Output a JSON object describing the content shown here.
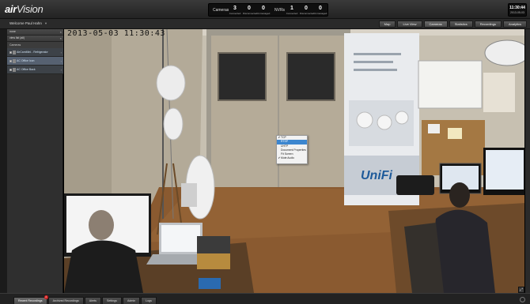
{
  "app": {
    "logo_prefix": "air",
    "logo_main": "Vision"
  },
  "stats": {
    "cameras_label": "Cameras",
    "nvrs_label": "NVRs",
    "cameras": [
      {
        "value": "3",
        "sub": "Connected"
      },
      {
        "value": "0",
        "sub": "Disconnected"
      },
      {
        "value": "0",
        "sub": "Unmanaged"
      }
    ],
    "nvrs": [
      {
        "value": "1",
        "sub": "Connected"
      },
      {
        "value": "0",
        "sub": "Disconnected"
      },
      {
        "value": "0",
        "sub": "Unmanaged"
      }
    ]
  },
  "clock": {
    "time": "11:30:44",
    "date": "2013-05-03"
  },
  "header": {
    "welcome": "Welcome Paul Hahn",
    "tabs": [
      "Map",
      "Live View",
      "Cameras",
      "Statistics",
      "Recordings",
      "Analytics"
    ],
    "active_tab": "Cameras"
  },
  "sidebar": {
    "rows": [
      {
        "label": "none"
      },
      {
        "label": "view list (all)"
      }
    ],
    "section_label": "Cameras",
    "cameras": [
      {
        "label": "AirCamMini - Refrigerator"
      },
      {
        "label": "AC Office Icon"
      },
      {
        "label": "AC Office Back"
      }
    ]
  },
  "video": {
    "timestamp": "2013-05-03 11:30:43",
    "context_menu": [
      {
        "label": "TCP",
        "checked": true
      },
      {
        "label": "RTSP",
        "checked": false,
        "highlight": true
      },
      {
        "label": "UHTP",
        "checked": false
      },
      {
        "label": "Document Properties",
        "checked": false
      },
      {
        "label": "Fit Screen",
        "checked": false
      },
      {
        "label": "Mute Audio",
        "checked": true
      }
    ]
  },
  "footer": {
    "tabs": [
      "Recent Recordings",
      "Archived Recordings",
      "Alerts",
      "Settings",
      "Admin",
      "Logs"
    ],
    "active_tab": "Recent Recordings",
    "badge": "4"
  },
  "colors": {
    "accent_blue": "#3c86cf",
    "badge_red": "#d42020"
  },
  "icons": [
    "close-icon",
    "fullscreen-icon",
    "checkmark-icon",
    "settings-icon"
  ]
}
